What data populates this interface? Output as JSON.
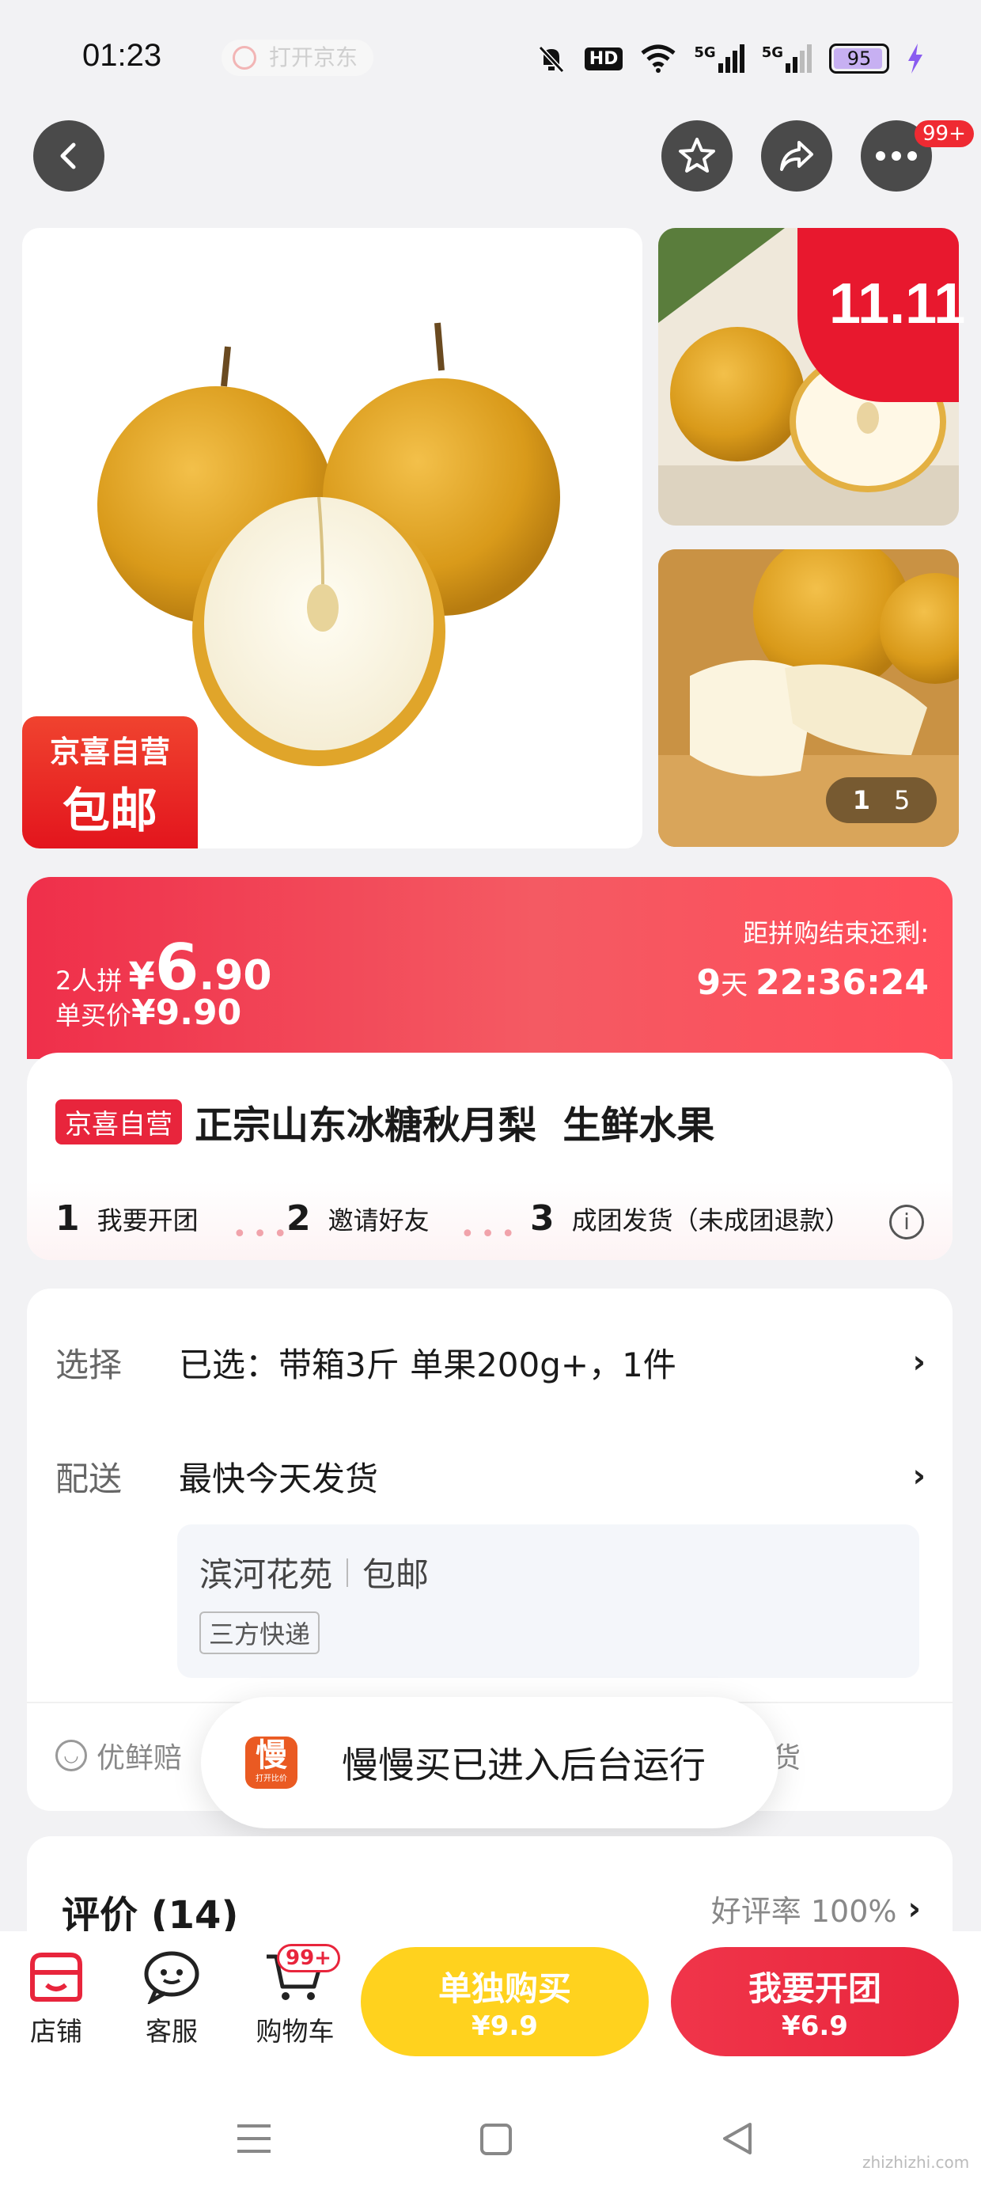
{
  "status_bar": {
    "time": "01:23",
    "open_app_label": "打开京东",
    "network_1": "5G",
    "network_2": "5G",
    "hd_label": "HD",
    "battery": "95"
  },
  "nav": {
    "more_badge": "99+"
  },
  "gallery": {
    "badge_line1": "京喜自营",
    "badge_line2": "包邮",
    "promo_badge": "11.11",
    "page_indicator_current": "1",
    "page_indicator_total": "5"
  },
  "promo": {
    "group_label": "2人拼",
    "currency": "¥",
    "group_price_int": "6",
    "group_price_dec": ".90",
    "single_label": "单买价",
    "single_price": "¥9.90",
    "countdown_label": "距拼购结束还剩:",
    "countdown_days": "9",
    "countdown_days_unit": "天",
    "countdown_time": "22:36:24"
  },
  "product": {
    "tag": "京喜自营",
    "title": "正宗山东冰糖秋月梨  生鲜水果",
    "steps": [
      {
        "num": "1",
        "label": "我要开团"
      },
      {
        "num": "2",
        "label": "邀请好友"
      },
      {
        "num": "3",
        "label": "成团发货（未成团退款）"
      }
    ]
  },
  "options": {
    "select_label": "选择",
    "select_value": "已选：带箱3斤  单果200g+，1件",
    "delivery_label": "配送",
    "delivery_value": "最快今天发货",
    "address": "滨河花苑",
    "shipping": "包邮",
    "courier": "三方快递",
    "guarantee_1": "优鲜赔",
    "guarantee_2": "货"
  },
  "toast": {
    "app_icon_text": "慢",
    "app_icon_sub": "打开比价",
    "message": "慢慢买已进入后台运行"
  },
  "reviews": {
    "title": "评价 (14)",
    "rate_label": "好评率 100%"
  },
  "bottom_bar": {
    "shop": "店铺",
    "service": "客服",
    "cart": "购物车",
    "cart_badge": "99+",
    "buy_alone_label": "单独购买",
    "buy_alone_price": "¥9.9",
    "group_buy_label": "我要开团",
    "group_buy_price": "¥6.9"
  },
  "watermark": "zhizhizhi.com",
  "colors": {
    "accent_red": "#e8253c",
    "yellow_button": "#ffd21e"
  }
}
